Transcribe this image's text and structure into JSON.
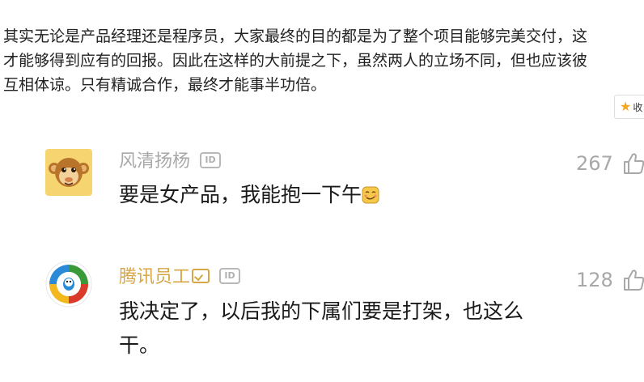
{
  "article": {
    "lines": [
      "其实无论是产品经理还是程序员，大家最终的目的都是为了整个项目能够完美交付，这",
      "才能够得到应有的回报。因此在这样的大前提之下，虽然两人的立场不同，但也应该彼",
      "互相体谅。只有精诚合作，最终才能事半功倍。"
    ]
  },
  "favorite_button": {
    "label": "收"
  },
  "comments": [
    {
      "username": "风清扬杨",
      "id_badge": "ID",
      "likes": "267",
      "text": "要是女产品，我能抱一下午",
      "avatar_icon": "monkey-avatar-icon",
      "emoji_icon": "smirk-emoji-icon",
      "name_color": "#a8a8a8"
    },
    {
      "username": "腾讯员工",
      "id_badge": "ID",
      "likes": "128",
      "text": "我决定了，以后我的下属们要是打架，也这么干。",
      "avatar_icon": "tencent-news-logo-avatar-icon",
      "verified_icon": "verified-badge-icon",
      "name_color": "#d6a645"
    }
  ],
  "colors": {
    "accent_gold": "#d6a645",
    "muted_gray": "#a8a8a8",
    "star": "#f5a623"
  }
}
